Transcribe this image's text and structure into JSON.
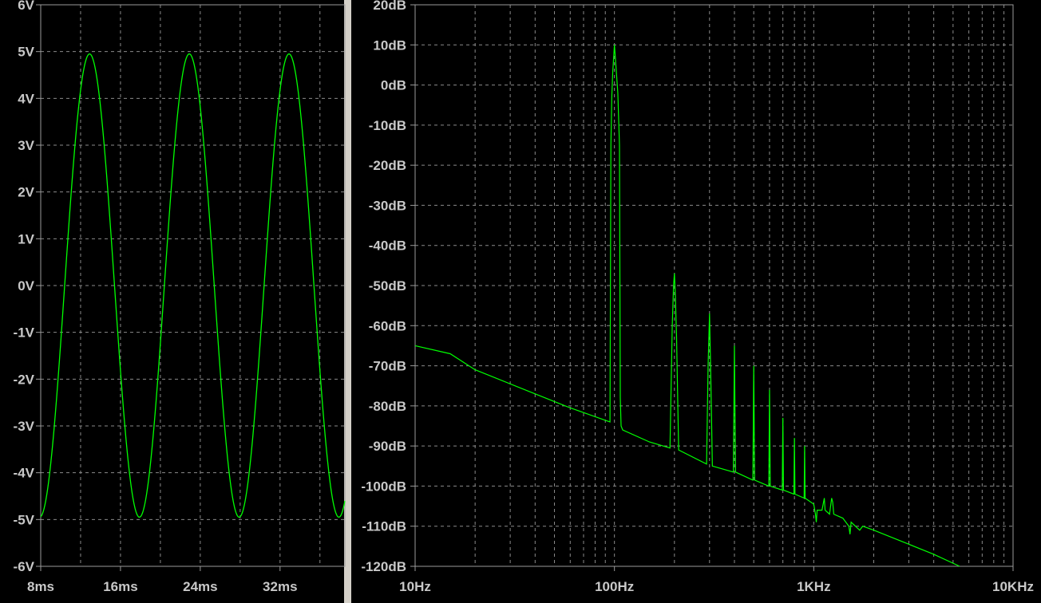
{
  "chart_data": [
    {
      "type": "line",
      "name": "time-domain",
      "y_ticks": [
        "6V",
        "5V",
        "4V",
        "3V",
        "2V",
        "1V",
        "0V",
        "-1V",
        "-2V",
        "-3V",
        "-4V",
        "-5V",
        "-6V"
      ],
      "x_ticks": [
        "8ms",
        "16ms",
        "24ms",
        "32ms"
      ],
      "xlim_ms": [
        8,
        38.5
      ],
      "ylim": [
        -6,
        6
      ],
      "series": [
        {
          "waveform": "sine",
          "amplitude_V": 4.95,
          "frequency_Hz": 100,
          "peak_time_ms": 12.9,
          "color": "#00ff00"
        }
      ],
      "grid": true
    },
    {
      "type": "line",
      "name": "fft",
      "y_ticks": [
        "20dB",
        "10dB",
        "0dB",
        "-10dB",
        "-20dB",
        "-30dB",
        "-40dB",
        "-50dB",
        "-60dB",
        "-70dB",
        "-80dB",
        "-90dB",
        "-100dB",
        "-110dB",
        "-120dB"
      ],
      "x_ticks": [
        "10Hz",
        "100Hz",
        "1KHz",
        "10KHz"
      ],
      "x_scale": "log",
      "xlim_Hz": [
        10,
        10000
      ],
      "ylim_dB": [
        -120,
        20
      ],
      "series": [
        {
          "color": "#00ff00",
          "points": [
            [
              10,
              -65
            ],
            [
              15,
              -67
            ],
            [
              20,
              -71
            ],
            [
              40,
              -77
            ],
            [
              60,
              -80.5
            ],
            [
              95,
              -84
            ],
            [
              96,
              -15
            ],
            [
              97,
              -3
            ],
            [
              98,
              3
            ],
            [
              100,
              10
            ],
            [
              102,
              4
            ],
            [
              104,
              -2
            ],
            [
              106,
              -15
            ],
            [
              107,
              -78
            ],
            [
              108,
              -85
            ],
            [
              110,
              -86
            ],
            [
              150,
              -89
            ],
            [
              190,
              -90.5
            ],
            [
              195,
              -60
            ],
            [
              198,
              -50
            ],
            [
              200,
              -47
            ],
            [
              202,
              -52
            ],
            [
              205,
              -63
            ],
            [
              210,
              -91
            ],
            [
              290,
              -94.5
            ],
            [
              295,
              -70
            ],
            [
              300,
              -57
            ],
            [
              305,
              -75
            ],
            [
              310,
              -95
            ],
            [
              395,
              -96.5
            ],
            [
              400,
              -65
            ],
            [
              405,
              -96.5
            ],
            [
              495,
              -98.5
            ],
            [
              500,
              -70
            ],
            [
              505,
              -98.5
            ],
            [
              595,
              -100
            ],
            [
              600,
              -76
            ],
            [
              605,
              -100
            ],
            [
              695,
              -101
            ],
            [
              700,
              -83
            ],
            [
              705,
              -101
            ],
            [
              795,
              -102
            ],
            [
              800,
              -88
            ],
            [
              805,
              -102
            ],
            [
              895,
              -103
            ],
            [
              900,
              -90
            ],
            [
              905,
              -103
            ],
            [
              1000,
              -104.5
            ],
            [
              1020,
              -107
            ],
            [
              1030,
              -109
            ],
            [
              1040,
              -106
            ],
            [
              1100,
              -106
            ],
            [
              1120,
              -104
            ],
            [
              1130,
              -103
            ],
            [
              1140,
              -106
            ],
            [
              1200,
              -107
            ],
            [
              1230,
              -103
            ],
            [
              1245,
              -104
            ],
            [
              1260,
              -107
            ],
            [
              1400,
              -108
            ],
            [
              1500,
              -110
            ],
            [
              1520,
              -112
            ],
            [
              1540,
              -109
            ],
            [
              1700,
              -111
            ],
            [
              1760,
              -110
            ],
            [
              2000,
              -111
            ],
            [
              3000,
              -114.5
            ],
            [
              4000,
              -117
            ],
            [
              5400,
              -120
            ]
          ]
        }
      ],
      "grid": true
    }
  ]
}
